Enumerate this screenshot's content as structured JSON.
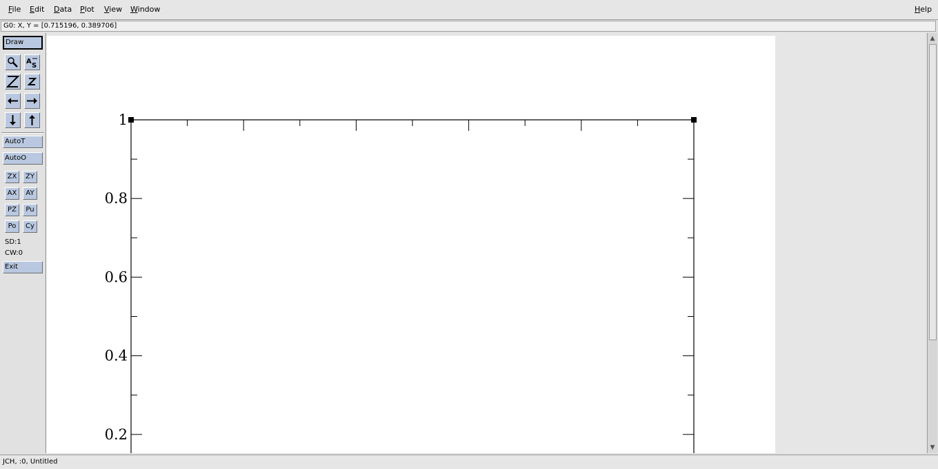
{
  "menubar": {
    "items": [
      {
        "label": "File",
        "u": "F",
        "rest": "ile"
      },
      {
        "label": "Edit",
        "u": "E",
        "rest": "dit"
      },
      {
        "label": "Data",
        "u": "D",
        "rest": "ata"
      },
      {
        "label": "Plot",
        "u": "P",
        "rest": "lot"
      },
      {
        "label": "View",
        "u": "V",
        "rest": "iew"
      },
      {
        "label": "Window",
        "u": "W",
        "rest": "indow"
      }
    ],
    "help": {
      "label": "Help",
      "u": "H",
      "rest": "elp"
    }
  },
  "locator": "G0: X, Y = [0.715196, 0.389706]",
  "toolbar": {
    "draw_label": "Draw",
    "autot_label": "AutoT",
    "autoo_label": "AutoO",
    "zx_label": "ZX",
    "zy_label": "ZY",
    "ax_label": "AX",
    "ay_label": "AY",
    "pz_label": "PZ",
    "pu_label": "Pu",
    "po_label": "Po",
    "cy_label": "Cy",
    "sd_label": "SD:1",
    "cw_label": "CW:0",
    "exit_label": "Exit",
    "icons": [
      "zoom-icon",
      "autoscale-icon",
      "zoom-out-icon",
      "zoom-in-icon",
      "scroll-left-icon",
      "scroll-right-icon",
      "scroll-down-icon",
      "scroll-up-icon"
    ]
  },
  "graph": {
    "y_tick_labels": [
      "1",
      "0.8",
      "0.6",
      "0.4",
      "0.2"
    ],
    "y_ticks": [
      1.0,
      0.8,
      0.6,
      0.4,
      0.2
    ]
  },
  "statusbar": "JCH, :0, Untitled",
  "colors": {
    "button": "#b9c8e0",
    "background": "#e1e1e1"
  }
}
